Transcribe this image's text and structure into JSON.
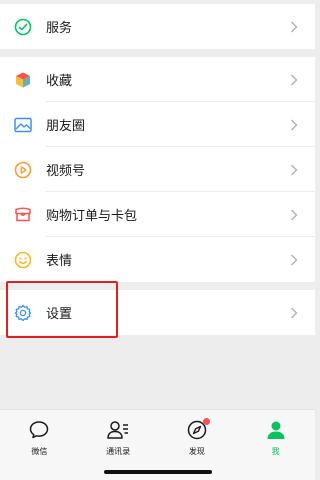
{
  "menu": {
    "items": [
      {
        "id": "services",
        "label": "服务",
        "icon": "services-icon"
      },
      {
        "id": "favorites",
        "label": "收藏",
        "icon": "favorites-icon"
      },
      {
        "id": "moments",
        "label": "朋友圈",
        "icon": "moments-icon"
      },
      {
        "id": "channels",
        "label": "视频号",
        "icon": "channels-icon"
      },
      {
        "id": "orders",
        "label": "购物订单与卡包",
        "icon": "orders-cards-icon"
      },
      {
        "id": "stickers",
        "label": "表情",
        "icon": "stickers-icon"
      },
      {
        "id": "settings",
        "label": "设置",
        "icon": "gear-icon"
      }
    ]
  },
  "tabbar": {
    "tabs": [
      {
        "id": "chats",
        "label": "微信",
        "icon": "chat-bubble-icon",
        "active": false
      },
      {
        "id": "contacts",
        "label": "通讯录",
        "icon": "contacts-icon",
        "active": false
      },
      {
        "id": "discover",
        "label": "发现",
        "icon": "compass-icon",
        "active": false,
        "badge": true
      },
      {
        "id": "me",
        "label": "我",
        "icon": "person-icon",
        "active": true
      }
    ]
  },
  "colors": {
    "accent_green": "#07c160",
    "highlight_red": "#e0201e",
    "badge_red": "#fa5151",
    "background": "#ededed"
  }
}
